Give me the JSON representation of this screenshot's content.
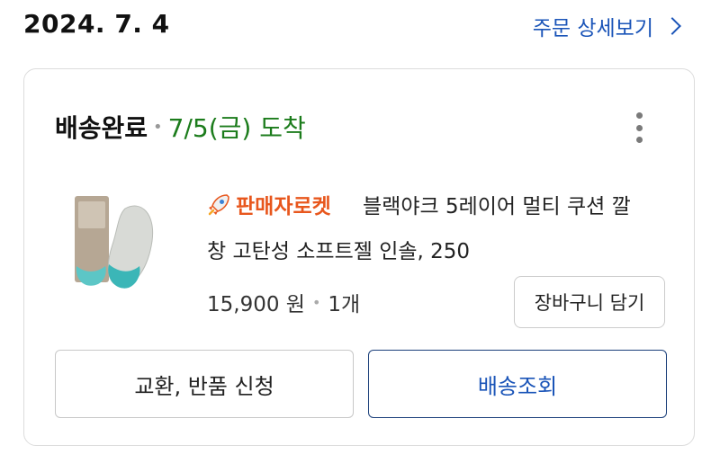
{
  "order": {
    "date": "2024. 7. 4",
    "detail_link": "주문 상세보기"
  },
  "shipment": {
    "status": "배송완료",
    "arrival": "7/5(금) 도착"
  },
  "product": {
    "badge": "판매자로켓",
    "title_line1": "블랙야크 5레이어 멀티 쿠션 깔",
    "title_line2": "창 고탄성 소프트젤 인솔, 250",
    "price": "15,900 원",
    "quantity": "1개",
    "thumbnail_icon": "insole-product-image",
    "badge_icon": "rocket-icon"
  },
  "actions": {
    "add_to_cart": "장바구니 담기",
    "return_exchange": "교환, 반품 신청",
    "track_delivery": "배송조회"
  },
  "colors": {
    "arrival": "#1c7c1c",
    "link": "#1a54b8",
    "rocket": "#e8571d"
  }
}
